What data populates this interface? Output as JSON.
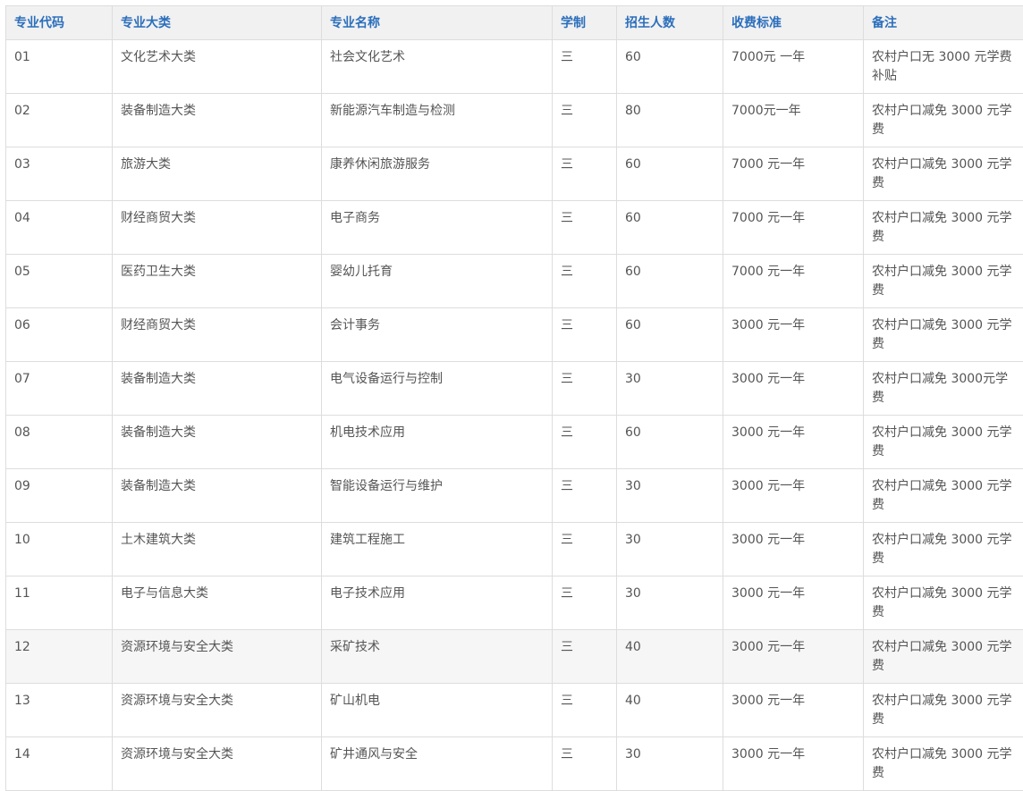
{
  "table": {
    "headers": [
      "专业代码",
      "专业大类",
      "专业名称",
      "学制",
      "招生人数",
      "收费标准",
      "备注"
    ],
    "rows": [
      [
        "01",
        "文化艺术大类",
        "社会文化艺术",
        "三",
        "60",
        "7000元 一年",
        "农村户口无 3000 元学费补贴"
      ],
      [
        "02",
        "装备制造大类",
        "新能源汽车制造与检测",
        "三",
        "80",
        "7000元一年",
        "农村户口减免 3000 元学费"
      ],
      [
        "03",
        "旅游大类",
        "康养休闲旅游服务",
        "三",
        "60",
        "7000 元一年",
        "农村户口减免 3000 元学费"
      ],
      [
        "04",
        "财经商贸大类",
        "电子商务",
        "三",
        "60",
        "7000 元一年",
        "农村户口减免 3000 元学费"
      ],
      [
        "05",
        "医药卫生大类",
        "婴幼儿托育",
        "三",
        "60",
        "7000 元一年",
        "农村户口减免 3000 元学费"
      ],
      [
        "06",
        "财经商贸大类",
        "会计事务",
        "三",
        "60",
        "3000 元一年",
        "农村户口减免 3000 元学费"
      ],
      [
        "07",
        "装备制造大类",
        "电气设备运行与控制",
        "三",
        "30",
        "3000 元一年",
        "农村户口减免 3000元学费"
      ],
      [
        "08",
        "装备制造大类",
        "机电技术应用",
        "三",
        "60",
        "3000 元一年",
        "农村户口减免 3000 元学费"
      ],
      [
        "09",
        "装备制造大类",
        "智能设备运行与维护",
        "三",
        "30",
        "3000 元一年",
        "农村户口减免 3000 元学费"
      ],
      [
        "10",
        "土木建筑大类",
        "建筑工程施工",
        "三",
        "30",
        "3000 元一年",
        "农村户口减免 3000 元学费"
      ],
      [
        "11",
        "电子与信息大类",
        "电子技术应用",
        "三",
        "30",
        "3000 元一年",
        "农村户口减免 3000 元学费"
      ],
      [
        "12",
        "资源环境与安全大类",
        "采矿技术",
        "三",
        "40",
        "3000 元一年",
        "农村户口减免 3000 元学费"
      ],
      [
        "13",
        "资源环境与安全大类",
        "矿山机电",
        "三",
        "40",
        "3000 元一年",
        "农村户口减免 3000 元学费"
      ],
      [
        "14",
        "资源环境与安全大类",
        "矿井通风与安全",
        "三",
        "30",
        "3000 元一年",
        "农村户口减免 3000 元学费"
      ]
    ]
  }
}
